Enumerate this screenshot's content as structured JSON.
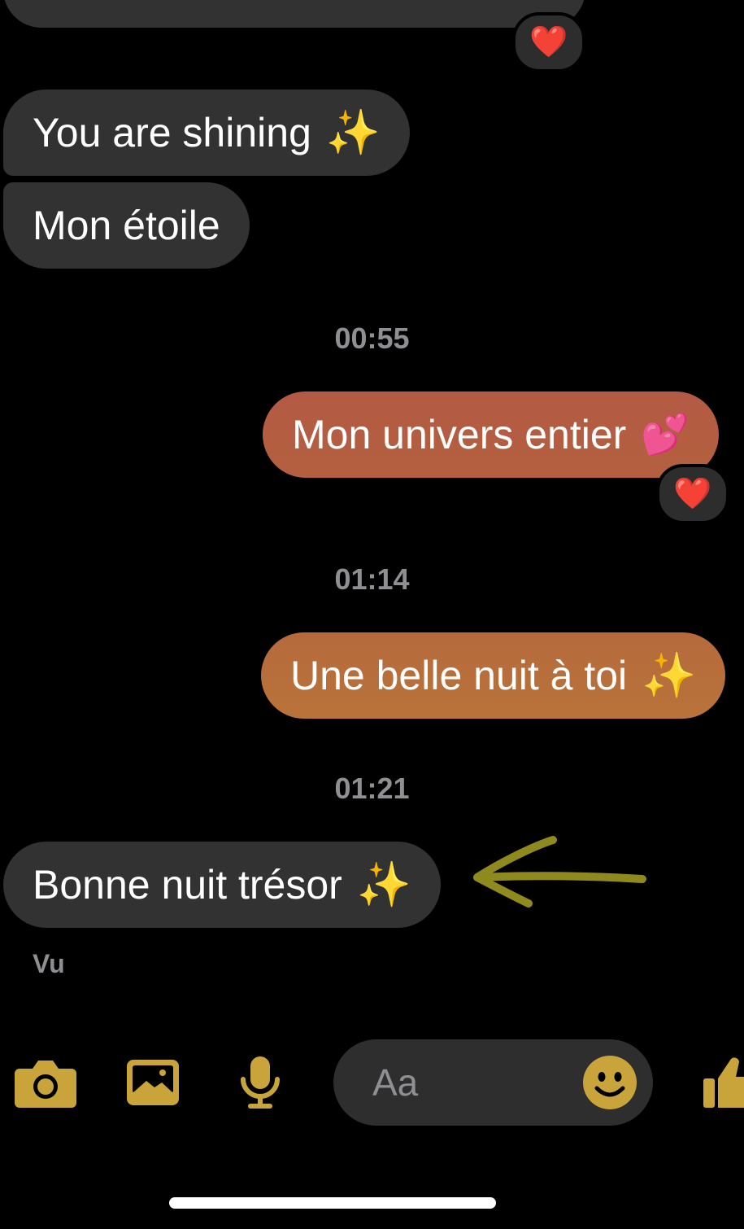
{
  "colors": {
    "background": "#000000",
    "incoming_bubble": "#323232",
    "outgoing_gradient_top": "#b35a44",
    "outgoing_gradient_bottom": "#b8733a",
    "accent": "#c9a43a",
    "timestamp": "#8e8e93",
    "annotation_arrow": "#8f8a1e"
  },
  "messages": [
    {
      "direction": "incoming",
      "text": "You are shining",
      "emoji": "✨"
    },
    {
      "direction": "incoming",
      "text": "Mon étoile",
      "emoji": ""
    },
    {
      "type": "timestamp",
      "text": "00:55"
    },
    {
      "direction": "outgoing",
      "text": "Mon univers entier",
      "emoji": "💕",
      "reaction": "❤️"
    },
    {
      "type": "timestamp",
      "text": "01:14"
    },
    {
      "direction": "outgoing",
      "text": "Une belle nuit à toi",
      "emoji": "✨"
    },
    {
      "type": "timestamp",
      "text": "01:21"
    },
    {
      "direction": "incoming",
      "text": "Bonne nuit trésor",
      "emoji": "✨"
    }
  ],
  "top_reaction": "❤️",
  "read_receipt": "Vu",
  "composer": {
    "placeholder": "Aa"
  },
  "toolbar_icons": [
    "camera-icon",
    "gallery-icon",
    "microphone-icon",
    "emoji-icon",
    "thumbs-up-icon"
  ]
}
